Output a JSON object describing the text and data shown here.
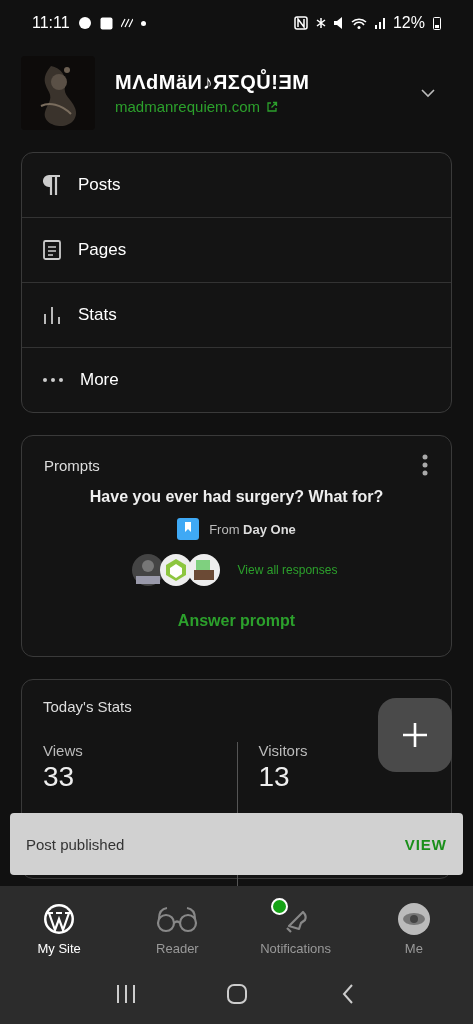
{
  "status_bar": {
    "time": "11:11",
    "battery": "12%"
  },
  "site": {
    "title": "MΛdMäИ♪ЯΣQŮ!ƎM",
    "url": "madmanrequiem.com"
  },
  "menu": [
    {
      "kind": "posts",
      "label": "Posts"
    },
    {
      "kind": "pages",
      "label": "Pages"
    },
    {
      "kind": "stats",
      "label": "Stats"
    },
    {
      "kind": "more",
      "label": "More"
    }
  ],
  "prompts": {
    "title": "Prompts",
    "question": "Have you ever had surgery? What for?",
    "source": "From **Day One**",
    "responses_link": "View all responses",
    "answer_button": "Answer prompt"
  },
  "todays_stats": {
    "title": "Today's Stats",
    "items": [
      {
        "label": "Views",
        "value": "33"
      },
      {
        "label": "Visitors",
        "value": "13"
      }
    ]
  },
  "snackbar": {
    "message": "Post published",
    "action": "VIEW"
  },
  "tabs": [
    {
      "kind": "mysite",
      "label": "My Site",
      "selected": true,
      "badge": false
    },
    {
      "kind": "reader",
      "label": "Reader",
      "selected": false,
      "badge": false
    },
    {
      "kind": "notifications",
      "label": "Notifications",
      "selected": false,
      "badge": true
    },
    {
      "kind": "me",
      "label": "Me",
      "selected": false,
      "badge": false
    }
  ]
}
